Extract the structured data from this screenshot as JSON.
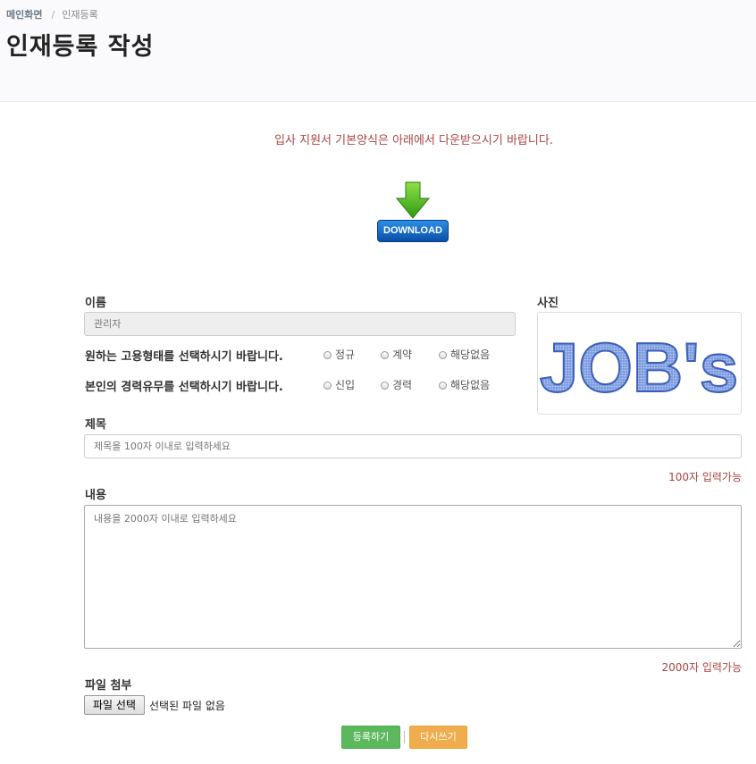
{
  "breadcrumb": {
    "home": "메인화면",
    "separator": "/",
    "current": "인재등록"
  },
  "page_title": "인재등록 작성",
  "notice": "입사 지원서 기본양식은 아래에서 다운받으시기 바랍니다.",
  "download": {
    "label": "DOWNLOAD",
    "icon": "download-arrow-icon"
  },
  "form": {
    "name_label": "이름",
    "name_value": "관리자",
    "employment": {
      "question": "원하는 고용형태를 선택하시기 바랍니다.",
      "options": [
        "정규",
        "계약",
        "해당없음"
      ]
    },
    "experience": {
      "question": "본인의 경력유무를 선택하시기 바랍니다.",
      "options": [
        "신입",
        "경력",
        "해당없음"
      ]
    },
    "photo_label": "사진",
    "photo_text": "JOB's",
    "title_label": "제목",
    "title_placeholder": "제목을 100자 이내로 입력하세요",
    "title_counter": "100자 입력가능",
    "content_label": "내용",
    "content_placeholder": "내용을 2000자 이내로 입력하세요",
    "content_counter": "2000자 입력가능",
    "file_label": "파일 첨부",
    "file_button": "파일 선택",
    "file_status": "선택된 파일 없음"
  },
  "actions": {
    "submit": "등록하기",
    "reset": "다시쓰기"
  },
  "colors": {
    "notice": "#a94442",
    "submit": "#5cb85c",
    "reset": "#f0ad4e",
    "download": "#0b4fa8"
  }
}
